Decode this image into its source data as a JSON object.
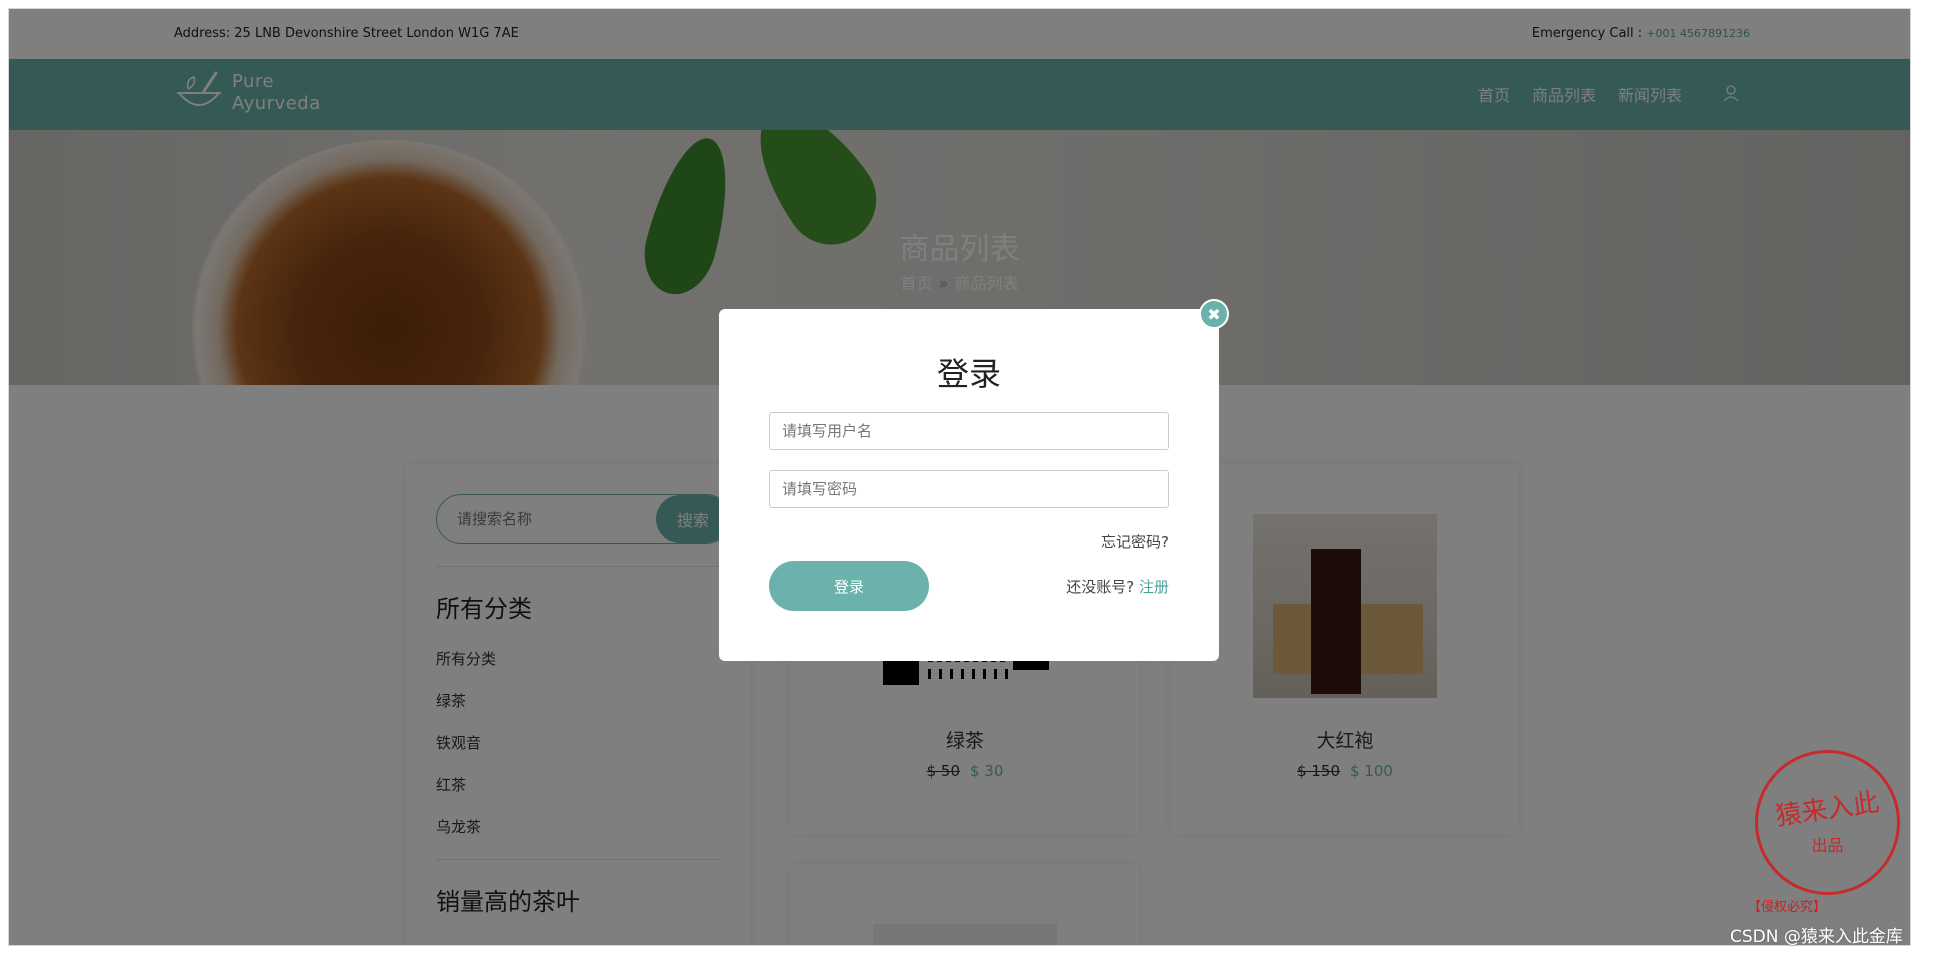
{
  "topbar": {
    "address": "Address: 25 LNB Devonshire Street London W1G 7AE",
    "emergency_label": "Emergency Call : ",
    "emergency_number": "+001 4567891236"
  },
  "header": {
    "logo_line1": "Pure",
    "logo_line2": "Ayurveda",
    "nav": [
      "首页",
      "商品列表",
      "新闻列表"
    ]
  },
  "banner": {
    "title": "商品列表",
    "crumb_home": "首页",
    "crumb_sep": "»",
    "crumb_current": "商品列表"
  },
  "sidebar": {
    "search_placeholder": "请搜索名称",
    "search_button": "搜索",
    "categories_title": "所有分类",
    "categories": [
      "所有分类",
      "绿茶",
      "铁观音",
      "红茶",
      "乌龙茶"
    ],
    "bestseller_title": "销量高的茶叶"
  },
  "products": [
    {
      "name": "绿茶",
      "old_price": "$ 50",
      "new_price": "$ 30"
    },
    {
      "name": "大红袍",
      "old_price": "$ 150",
      "new_price": "$ 100"
    }
  ],
  "modal": {
    "title": "登录",
    "username_placeholder": "请填写用户名",
    "password_placeholder": "请填写密码",
    "forgot": "忘记密码?",
    "login_button": "登录",
    "no_account": "还没账号?",
    "register": "注册"
  },
  "watermark": {
    "stamp_main": "猿来入此",
    "stamp_sub": "出品",
    "stamp_note": "【侵权必究】",
    "credit": "CSDN @猿来入此金库"
  },
  "colors": {
    "accent": "#6ab2ab",
    "overlay": "rgba(0,0,0,0.5)",
    "stamp": "#d31c1c"
  }
}
